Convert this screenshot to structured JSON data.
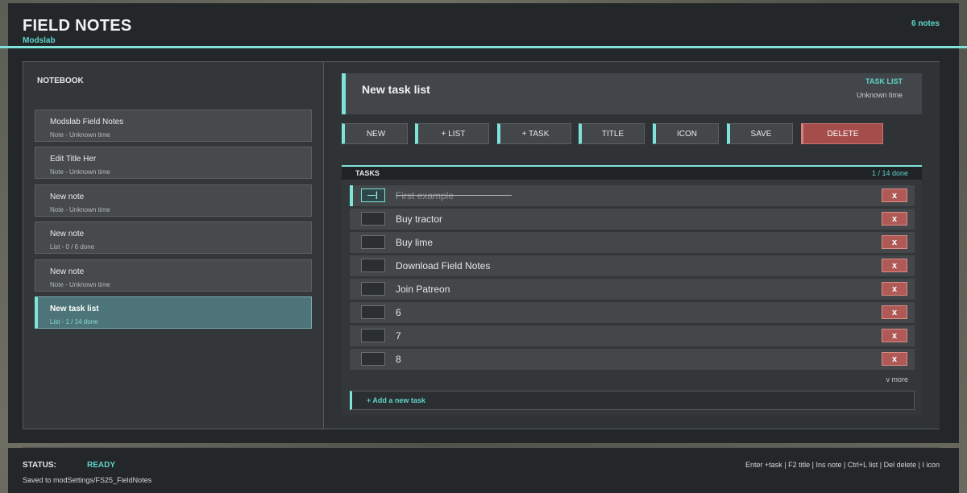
{
  "app": {
    "title": "FIELD NOTES",
    "subtitle": "Modslab",
    "note_count": "6 notes"
  },
  "sidebar": {
    "title": "NOTEBOOK",
    "notes": [
      {
        "title": "Modslab Field Notes",
        "meta": "Note - Unknown time"
      },
      {
        "title": "Edit Title Her",
        "meta": "Note - Unknown time"
      },
      {
        "title": "New note",
        "meta": "Note - Unknown time"
      },
      {
        "title": "New note",
        "meta": "List - 0 / 6 done"
      },
      {
        "title": "New note",
        "meta": "Note - Unknown time"
      },
      {
        "title": "New task list",
        "meta": "List - 1 / 14 done",
        "selected": true
      }
    ]
  },
  "note_header": {
    "title": "New task list",
    "type": "TASK LIST",
    "time": "Unknown time"
  },
  "toolbar": {
    "new": "NEW",
    "add_list": "+ LIST",
    "add_task": "+ TASK",
    "title": "TITLE",
    "icon": "ICON",
    "save": "SAVE",
    "delete": "DELETE"
  },
  "tasks": {
    "title": "TASKS",
    "progress": "1 / 14 done",
    "delete_label": "x",
    "items": [
      {
        "label": "First example",
        "done": true
      },
      {
        "label": "Buy tractor",
        "done": false
      },
      {
        "label": "Buy lime",
        "done": false
      },
      {
        "label": "Download Field Notes",
        "done": false
      },
      {
        "label": "Join Patreon",
        "done": false
      },
      {
        "label": "6",
        "done": false
      },
      {
        "label": "7",
        "done": false
      },
      {
        "label": "8",
        "done": false
      }
    ],
    "more": "v more",
    "add_new": "+ Add a new task"
  },
  "status": {
    "label": "STATUS:",
    "value": "READY",
    "saved": "Saved to modSettings/FS25_FieldNotes",
    "shortcuts": "Enter +task | F2 title | Ins note | Ctrl+L list | Del delete | I icon"
  },
  "colors": {
    "accent": "#7fe3da",
    "accent_text": "#5fd4c8",
    "danger": "#a54d4a",
    "background": "#23272a"
  }
}
